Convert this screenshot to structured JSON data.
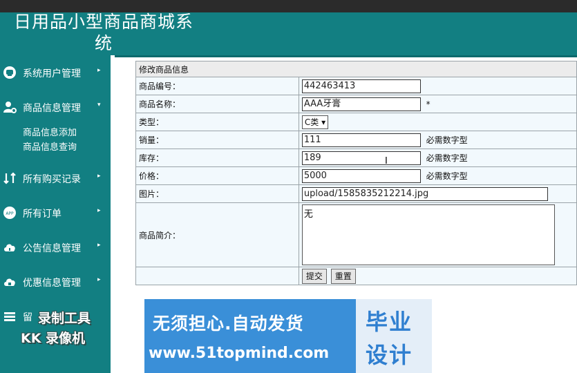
{
  "header": {
    "title": "日用品小型商品商城系统"
  },
  "sidebar": {
    "items": [
      {
        "label": "系统用户管理",
        "icon": "user-icon",
        "arrow": "▸"
      },
      {
        "label": "商品信息管理",
        "icon": "goods-settings-icon",
        "arrow": "▾"
      },
      {
        "label": "所有购买记录",
        "icon": "records-icon",
        "arrow": "▸"
      },
      {
        "label": "所有订单",
        "icon": "app-icon",
        "arrow": "▸"
      },
      {
        "label": "公告信息管理",
        "icon": "cloud-icon",
        "arrow": "▸"
      },
      {
        "label": "优惠信息管理",
        "icon": "lock-icon",
        "arrow": "▸"
      },
      {
        "label": "留",
        "icon": "stack-icon",
        "arrow": ""
      }
    ],
    "subitems": [
      "商品信息添加",
      "商品信息查询"
    ]
  },
  "form": {
    "caption": "修改商品信息",
    "rows": {
      "code": {
        "label": "商品编号：",
        "value": "442463413"
      },
      "name": {
        "label": "商品名称：",
        "value": "AAA牙膏",
        "hint": "*"
      },
      "type": {
        "label": "类型：",
        "value": "C类",
        "arrow": "▾"
      },
      "sales": {
        "label": "销量：",
        "value": "111",
        "hint": "必需数字型"
      },
      "stock": {
        "label": "库存：",
        "value": "189",
        "hint": "必需数字型"
      },
      "price": {
        "label": "价格：",
        "value": "5000",
        "hint": "必需数字型"
      },
      "image": {
        "label": "图片：",
        "value": "upload/1585835212214.jpg"
      },
      "intro": {
        "label": "商品简介：",
        "value": "无"
      }
    },
    "buttons": {
      "submit": "提交",
      "reset": "重置"
    }
  },
  "banner": {
    "line1": "无须担心.自动发货",
    "line2": "www.51topmind.com",
    "right1": "毕业",
    "right2": "设计"
  },
  "watermark": {
    "line1": "录制工具",
    "line2": "KK 录像机"
  },
  "colors": {
    "teal": "#127f82",
    "banner_blue": "#3a8fd8",
    "cell_bg": "#f2f9fd"
  }
}
